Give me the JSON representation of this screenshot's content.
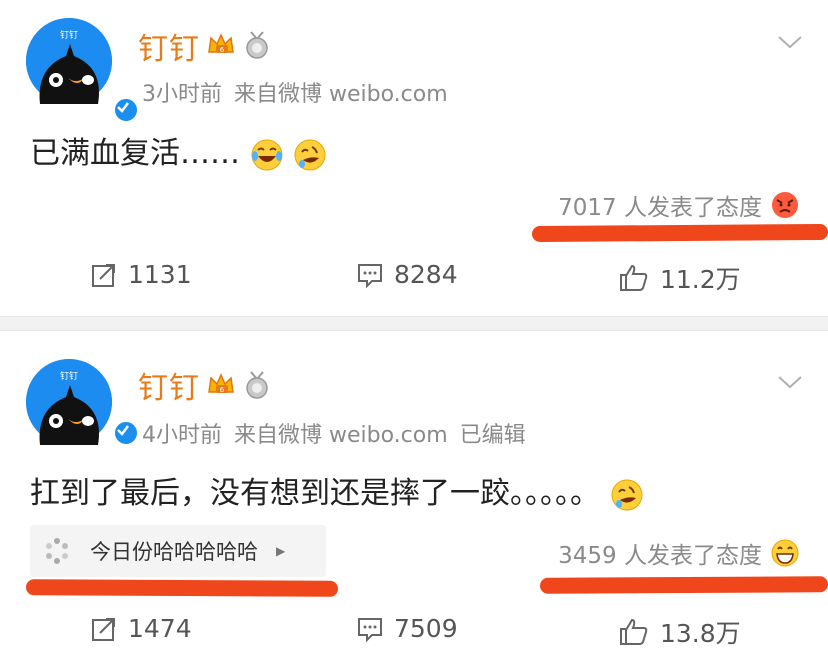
{
  "posts": [
    {
      "author": "钉钉",
      "time": "3小时前",
      "source": "来自微博 weibo.com",
      "edited": "",
      "text": "已满血复活……",
      "attitude": "7017 人发表了态度",
      "repost_count": "1131",
      "comment_count": "8284",
      "like_count": "11.2万"
    },
    {
      "author": "钉钉",
      "time": "4小时前",
      "source": "来自微博 weibo.com",
      "edited": "已编辑",
      "text": "扛到了最后，没有想到还是摔了一跤。。。。。",
      "topic": "今日份哈哈哈哈哈",
      "attitude": "3459 人发表了态度",
      "repost_count": "1474",
      "comment_count": "7509",
      "like_count": "13.8万"
    }
  ],
  "avatar_label": "钉钉",
  "colors": {
    "name": "#e87b18",
    "avatar_bg": "#1d8cf0",
    "highlight": "#f0461c",
    "meta": "#8a8a8a"
  }
}
